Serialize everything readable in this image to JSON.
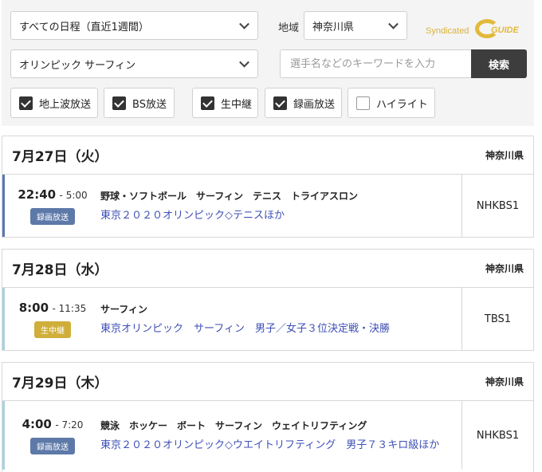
{
  "filters": {
    "period": "すべての日程（直近1週間）",
    "region_label": "地域",
    "region": "神奈川県",
    "program": "オリンピック サーフィン",
    "search_placeholder": "選手名などのキーワードを入力",
    "search_button": "検索",
    "logo_text": "Syndicated",
    "logo_mark": "GUIDE",
    "checkboxes": [
      {
        "label": "地上波放送",
        "checked": true
      },
      {
        "label": "BS放送",
        "checked": true
      },
      {
        "label": "生中継",
        "checked": true
      },
      {
        "label": "録画放送",
        "checked": true
      },
      {
        "label": "ハイライト",
        "checked": false
      }
    ]
  },
  "days": [
    {
      "title": "7月27日（火）",
      "region": "神奈川県",
      "program": {
        "start": "22:40",
        "end": "- 5:00",
        "badge": "録画放送",
        "genre": "野球・ソフトボール　サーフィン　テニス　トライアスロン",
        "title": "東京２０２０オリンピック◇テニスほか",
        "channel": "NHKBS1"
      }
    },
    {
      "title": "7月28日（水）",
      "region": "神奈川県",
      "program": {
        "start": "8:00",
        "end": "- 11:35",
        "badge": "生中継",
        "genre": "サーフィン",
        "title": "東京オリンピック　サーフィン　男子／女子３位決定戦・決勝",
        "channel": "TBS1"
      }
    },
    {
      "title": "7月29日（木）",
      "region": "神奈川県",
      "program": {
        "start": "4:00",
        "end": "- 7:20",
        "badge": "録画放送",
        "genre": "競泳　ホッケー　ボート　サーフィン　ウェイトリフティング",
        "title": "東京２０２０オリンピック◇ウエイトリフティング　男子７３キロ級ほか",
        "channel": "NHKBS1"
      }
    }
  ]
}
